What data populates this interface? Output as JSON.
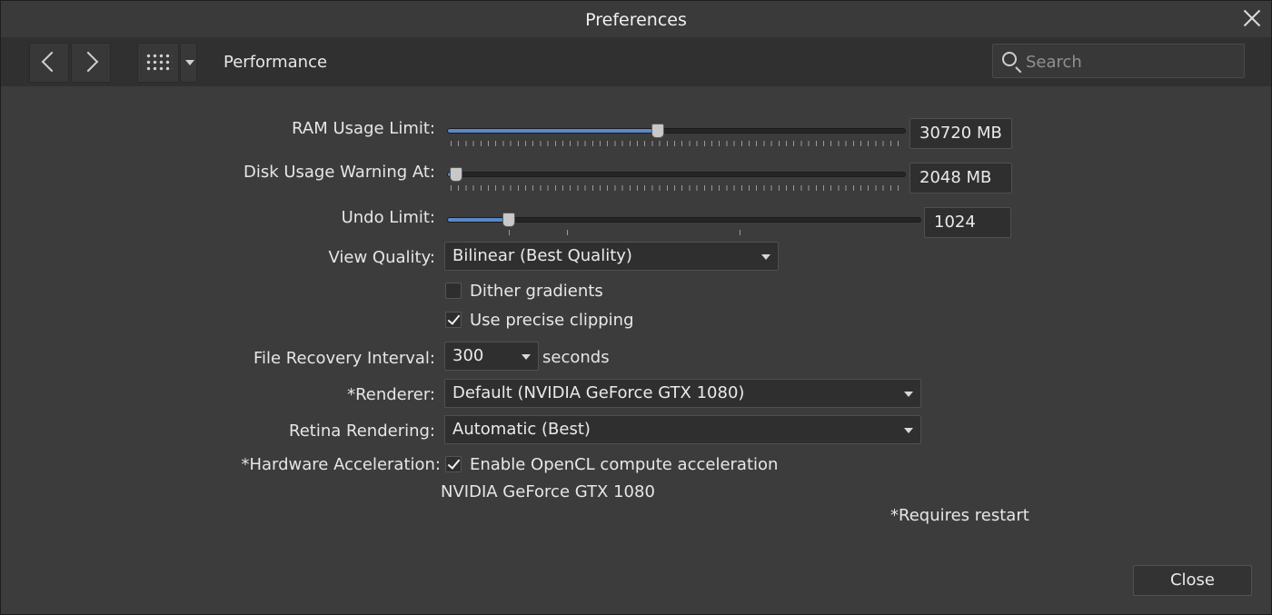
{
  "window": {
    "title": "Preferences"
  },
  "toolbar": {
    "breadcrumb": "Performance",
    "search_placeholder": "Search"
  },
  "settings": {
    "ram": {
      "label": "RAM Usage Limit:",
      "value": "30720 MB",
      "fraction": 0.46
    },
    "disk": {
      "label": "Disk Usage Warning At:",
      "value": "2048 MB",
      "fraction": 0.02
    },
    "undo": {
      "label": "Undo Limit:",
      "value": "1024",
      "fraction": 0.13
    },
    "view_quality": {
      "label": "View Quality:",
      "selected": "Bilinear (Best Quality)"
    },
    "dither": {
      "label": "Dither gradients",
      "checked": false
    },
    "precise_clipping": {
      "label": "Use precise clipping",
      "checked": true
    },
    "file_recovery": {
      "label": "File Recovery Interval:",
      "selected": "300",
      "unit": "seconds"
    },
    "renderer": {
      "label": "*Renderer:",
      "selected": "Default (NVIDIA GeForce GTX 1080)"
    },
    "retina": {
      "label": "Retina Rendering:",
      "selected": "Automatic (Best)"
    },
    "hardware": {
      "label": "*Hardware Acceleration:",
      "option": "Enable OpenCL compute acceleration",
      "checked": true,
      "device": "NVIDIA GeForce GTX 1080"
    },
    "restart_note": "*Requires restart"
  },
  "footer": {
    "close_label": "Close"
  },
  "colors": {
    "accent": "#5b87c9",
    "background": "#3c3c3c",
    "toolbar": "#303030"
  }
}
